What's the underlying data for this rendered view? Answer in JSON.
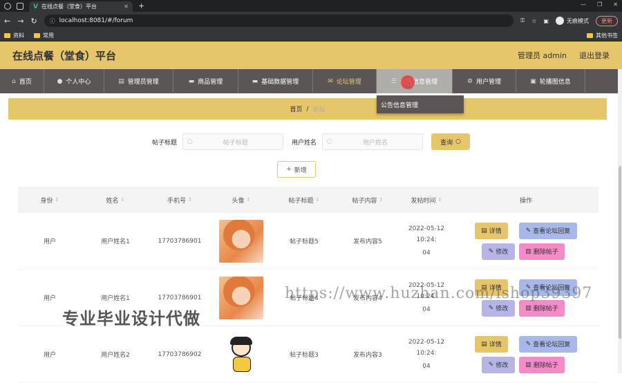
{
  "browser": {
    "tab_title": "在线点餐（堂食）平台",
    "url": "localhost:8081/#/forum",
    "incognito_label": "无痕模式",
    "update_label": "更新",
    "bookmarks": [
      "资料",
      "常用"
    ],
    "other_bookmarks": "其他书签"
  },
  "header": {
    "title": "在线点餐（堂食）平台",
    "user_label": "管理员 admin",
    "logout_label": "退出登录"
  },
  "nav": {
    "items": [
      {
        "label": "首页",
        "icon": "home-icon"
      },
      {
        "label": "个人中心",
        "icon": "user-icon"
      },
      {
        "label": "管理员管理",
        "icon": "admin-icon"
      },
      {
        "label": "商品管理",
        "icon": "goods-icon"
      },
      {
        "label": "基础数据管理",
        "icon": "data-icon"
      },
      {
        "label": "论坛管理",
        "icon": "forum-icon"
      },
      {
        "label": "公告信息管理",
        "icon": "notice-icon"
      },
      {
        "label": "用户管理",
        "icon": "users-icon"
      },
      {
        "label": "轮播图信息",
        "icon": "carousel-icon"
      }
    ],
    "dropdown_item": "公告信息管理"
  },
  "breadcrumb": {
    "home": "首页",
    "separator": "/",
    "current": "论坛"
  },
  "search": {
    "title_label": "帖子标题",
    "title_placeholder": "帖子标题",
    "user_label": "用户姓名",
    "user_placeholder": "用户姓名",
    "query_button": "查询",
    "add_button": "新增"
  },
  "table": {
    "headers": [
      "身份",
      "姓名",
      "手机号",
      "头像",
      "帖子标题",
      "帖子内容",
      "发帖时间",
      "操作"
    ],
    "rows": [
      {
        "role": "用户",
        "name": "用户姓名1",
        "phone": "17703786901",
        "avatar": "photo",
        "title": "帖子标题5",
        "content": "发布内容5",
        "time_line1": "2022-05-12 10:24:",
        "time_line2": "04"
      },
      {
        "role": "用户",
        "name": "用户姓名1",
        "phone": "17703786901",
        "avatar": "photo",
        "title": "帖子标题4",
        "content": "发布内容4",
        "time_line1": "2022-05-12 10:24:",
        "time_line2": "04"
      },
      {
        "role": "用户",
        "name": "用户姓名2",
        "phone": "17703786902",
        "avatar": "cartoon",
        "title": "帖子标题3",
        "content": "发布内容3",
        "time_line1": "2022-05-12 10:24:",
        "time_line2": "04"
      }
    ],
    "actions": {
      "detail": "详情",
      "reply": "查看论坛回复",
      "edit": "修改",
      "delete": "删除帖子"
    }
  },
  "watermarks": {
    "left": "专业毕业设计代做",
    "right": "https://www.huzhan.com/ishop39397"
  },
  "colors": {
    "accent": "#e7c56b",
    "nav_bg": "#5b5654",
    "reply_btn": "#a8b8e8",
    "edit_btn": "#b7b5e8",
    "delete_btn": "#f28bc8"
  }
}
